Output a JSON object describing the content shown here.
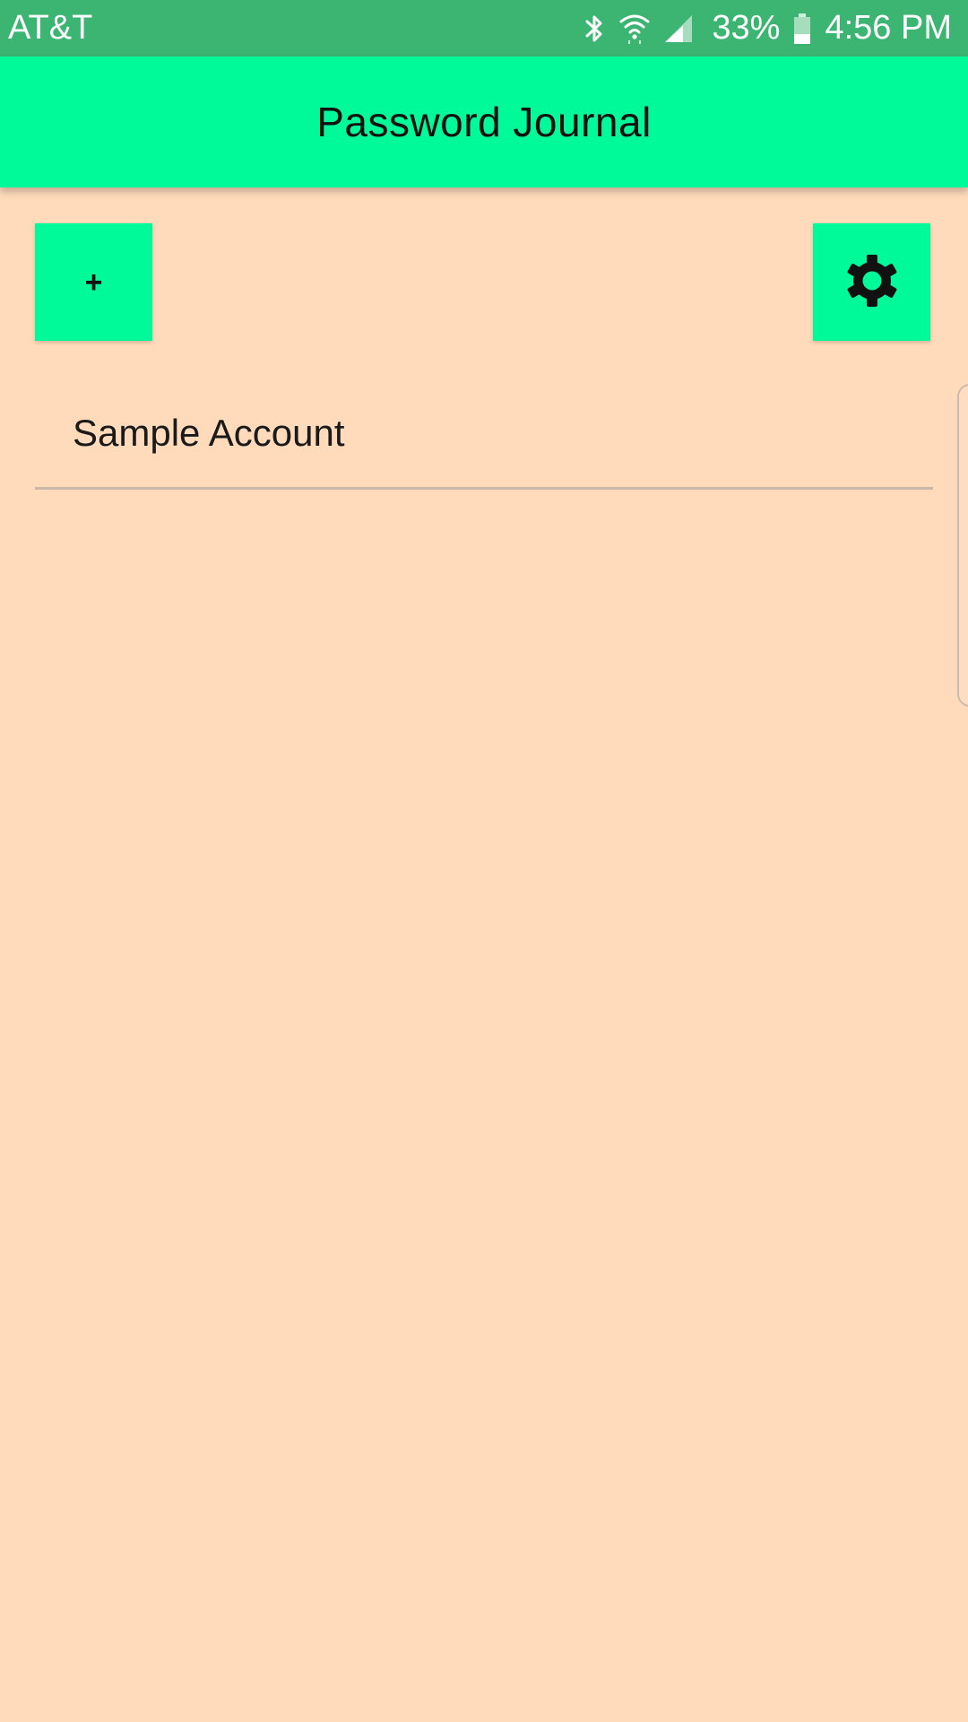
{
  "status_bar": {
    "carrier": "AT&T",
    "battery_percent": "33%",
    "time": "4:56 PM",
    "icons": [
      "bluetooth-icon",
      "wifi-icon",
      "signal-icon",
      "battery-icon"
    ],
    "background_color": "#3DB572"
  },
  "app_bar": {
    "title": "Password Journal",
    "background_color": "#00FA9A"
  },
  "toolbar": {
    "add_label": "+",
    "settings_icon": "gear-icon",
    "button_color": "#00FA9A"
  },
  "accounts": [
    {
      "label": "Sample Account"
    }
  ],
  "theme": {
    "background_color": "#FFDBBB"
  }
}
